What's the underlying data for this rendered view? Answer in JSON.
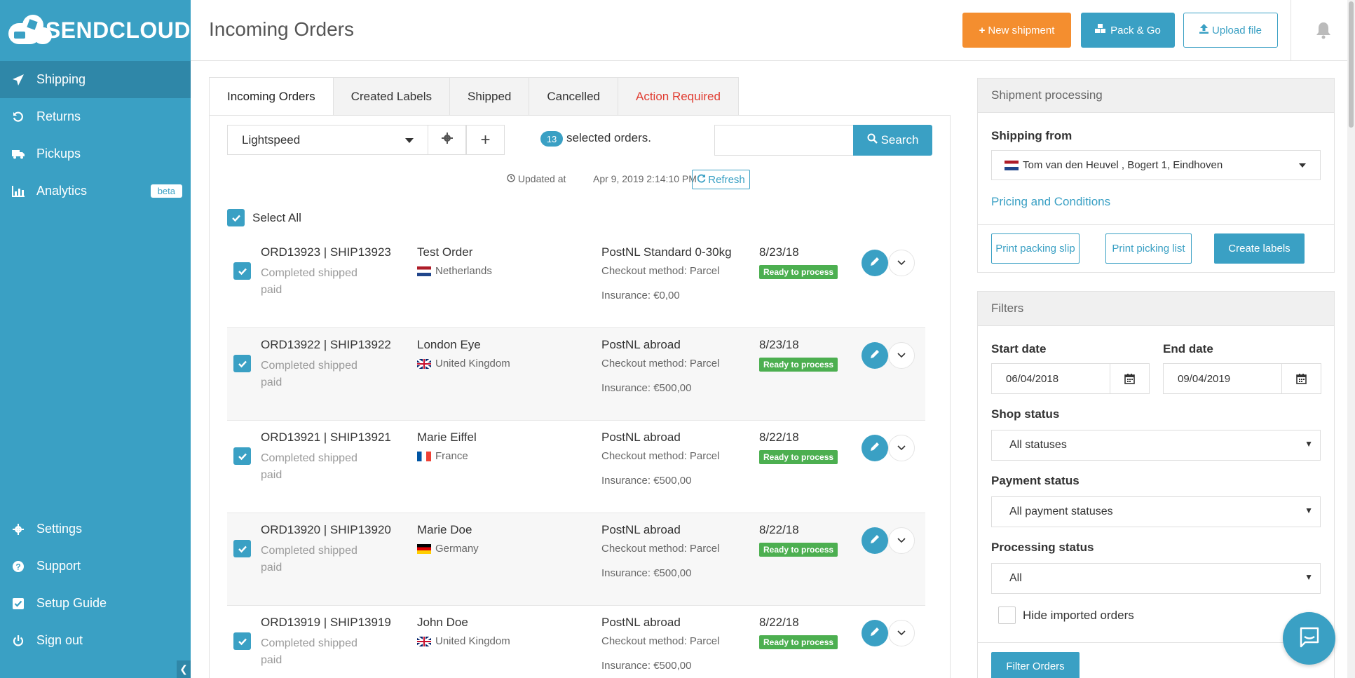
{
  "brand": {
    "name": "SENDCLOUD"
  },
  "sidebar": {
    "items": [
      {
        "label": "Shipping",
        "icon": "paper-plane-icon"
      },
      {
        "label": "Returns",
        "icon": "undo-icon"
      },
      {
        "label": "Pickups",
        "icon": "truck-icon"
      },
      {
        "label": "Analytics",
        "icon": "bar-chart-icon",
        "badge": "beta"
      }
    ],
    "bottom_items": [
      {
        "label": "Settings",
        "icon": "gear-icon"
      },
      {
        "label": "Support",
        "icon": "question-circle-icon"
      },
      {
        "label": "Setup Guide",
        "icon": "check-square-icon"
      },
      {
        "label": "Sign out",
        "icon": "power-icon"
      }
    ]
  },
  "header": {
    "title": "Incoming Orders",
    "new_shipment": "New shipment",
    "pack_go": "Pack & Go",
    "upload_file": "Upload file"
  },
  "tabs": [
    "Incoming Orders",
    "Created Labels",
    "Shipped",
    "Cancelled",
    "Action Required"
  ],
  "toolbar": {
    "shop": "Lightspeed",
    "selected_count": "13",
    "selected_text": "selected orders.",
    "search_value": "",
    "search_label": "Search",
    "updated_label": "Updated at",
    "updated_time": "Apr 9, 2019 2:14:10 PM",
    "refresh_label": "Refresh",
    "select_all": "Select All"
  },
  "orders": [
    {
      "id": "ORD13923 | SHIP13923",
      "status1": "Completed shipped",
      "status2": "paid",
      "name": "Test Order",
      "country": "Netherlands",
      "carrier": "PostNL Standard 0-30kg",
      "checkout": "Checkout method: Parcel",
      "insurance": "Insurance: €0,00",
      "date": "8/23/18",
      "badge": "Ready to process"
    },
    {
      "id": "ORD13922 | SHIP13922",
      "status1": "Completed shipped",
      "status2": "paid",
      "name": "London Eye",
      "country": "United Kingdom",
      "carrier": "PostNL abroad",
      "checkout": "Checkout method: Parcel",
      "insurance": "Insurance: €500,00",
      "date": "8/23/18",
      "badge": "Ready to process"
    },
    {
      "id": "ORD13921 | SHIP13921",
      "status1": "Completed shipped",
      "status2": "paid",
      "name": "Marie Eiffel",
      "country": "France",
      "carrier": "PostNL abroad",
      "checkout": "Checkout method: Parcel",
      "insurance": "Insurance: €500,00",
      "date": "8/22/18",
      "badge": "Ready to process"
    },
    {
      "id": "ORD13920 | SHIP13920",
      "status1": "Completed shipped",
      "status2": "paid",
      "name": "Marie Doe",
      "country": "Germany",
      "carrier": "PostNL abroad",
      "checkout": "Checkout method: Parcel",
      "insurance": "Insurance: €500,00",
      "date": "8/22/18",
      "badge": "Ready to process"
    },
    {
      "id": "ORD13919 | SHIP13919",
      "status1": "Completed shipped",
      "status2": "paid",
      "name": "John Doe",
      "country": "United Kingdom",
      "carrier": "PostNL abroad",
      "checkout": "Checkout method: Parcel",
      "insurance": "Insurance: €500,00",
      "date": "8/22/18",
      "badge": "Ready to process"
    }
  ],
  "processing": {
    "title": "Shipment processing",
    "shipping_from_label": "Shipping from",
    "shipping_from_value": "Tom van den Heuvel , Bogert 1, Eindhoven",
    "pricing_link": "Pricing and Conditions",
    "print_packing_slip": "Print packing slip",
    "print_picking_list": "Print picking list",
    "create_labels": "Create labels"
  },
  "filters": {
    "title": "Filters",
    "start_date_label": "Start date",
    "start_date": "06/04/2018",
    "end_date_label": "End date",
    "end_date": "09/04/2019",
    "shop_status_label": "Shop status",
    "shop_status": "All statuses",
    "payment_status_label": "Payment status",
    "payment_status": "All payment statuses",
    "processing_status_label": "Processing status",
    "processing_status": "All",
    "hide_imported": "Hide imported orders",
    "filter_button": "Filter Orders"
  },
  "colors": {
    "brand": "#3aa0c4",
    "accent": "#f48e2f",
    "success": "#4caf50",
    "danger": "#e03c31"
  }
}
